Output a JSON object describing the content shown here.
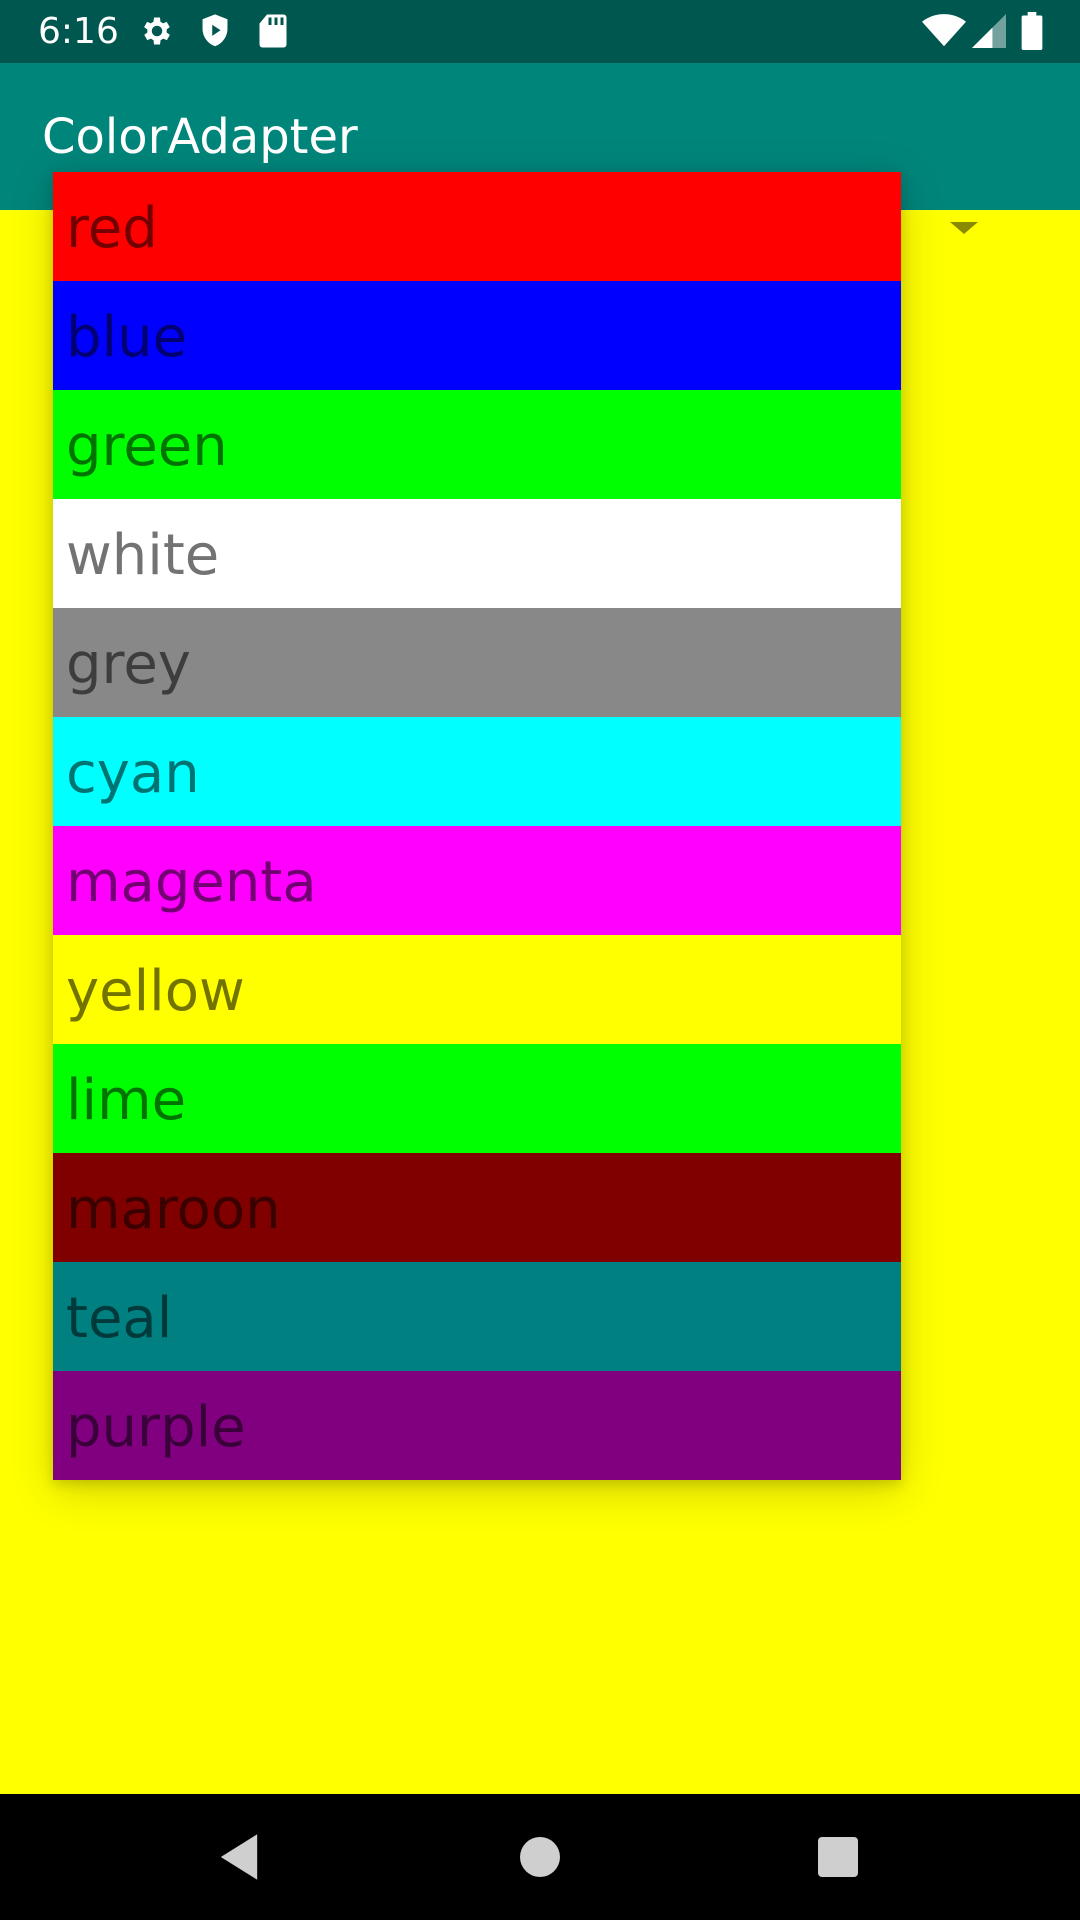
{
  "status_bar": {
    "time": "6:16",
    "icons_left": [
      "gear-icon",
      "shield-play-icon",
      "sd-card-icon"
    ],
    "icons_right": [
      "wifi-icon",
      "cell-signal-icon",
      "battery-icon"
    ]
  },
  "app_bar": {
    "title": "ColorAdapter"
  },
  "colors": {
    "status_bar_bg": "#00574f",
    "app_bar_bg": "#00857a",
    "content_bg": "#ffff00",
    "nav_bar_bg": "#000000"
  },
  "dropdown": {
    "items": [
      {
        "label": "red",
        "color": "#ff0000"
      },
      {
        "label": "blue",
        "color": "#0000ff"
      },
      {
        "label": "green",
        "color": "#00ff00"
      },
      {
        "label": "white",
        "color": "#ffffff"
      },
      {
        "label": "grey",
        "color": "#888888"
      },
      {
        "label": "cyan",
        "color": "#00ffff"
      },
      {
        "label": "magenta",
        "color": "#ff00ff"
      },
      {
        "label": "yellow",
        "color": "#ffff00"
      },
      {
        "label": "lime",
        "color": "#00ff00"
      },
      {
        "label": "maroon",
        "color": "#800000"
      },
      {
        "label": "teal",
        "color": "#008080"
      },
      {
        "label": "purple",
        "color": "#800080"
      }
    ]
  },
  "nav_bar": {
    "buttons": [
      "back-icon",
      "home-icon",
      "recents-icon"
    ]
  }
}
